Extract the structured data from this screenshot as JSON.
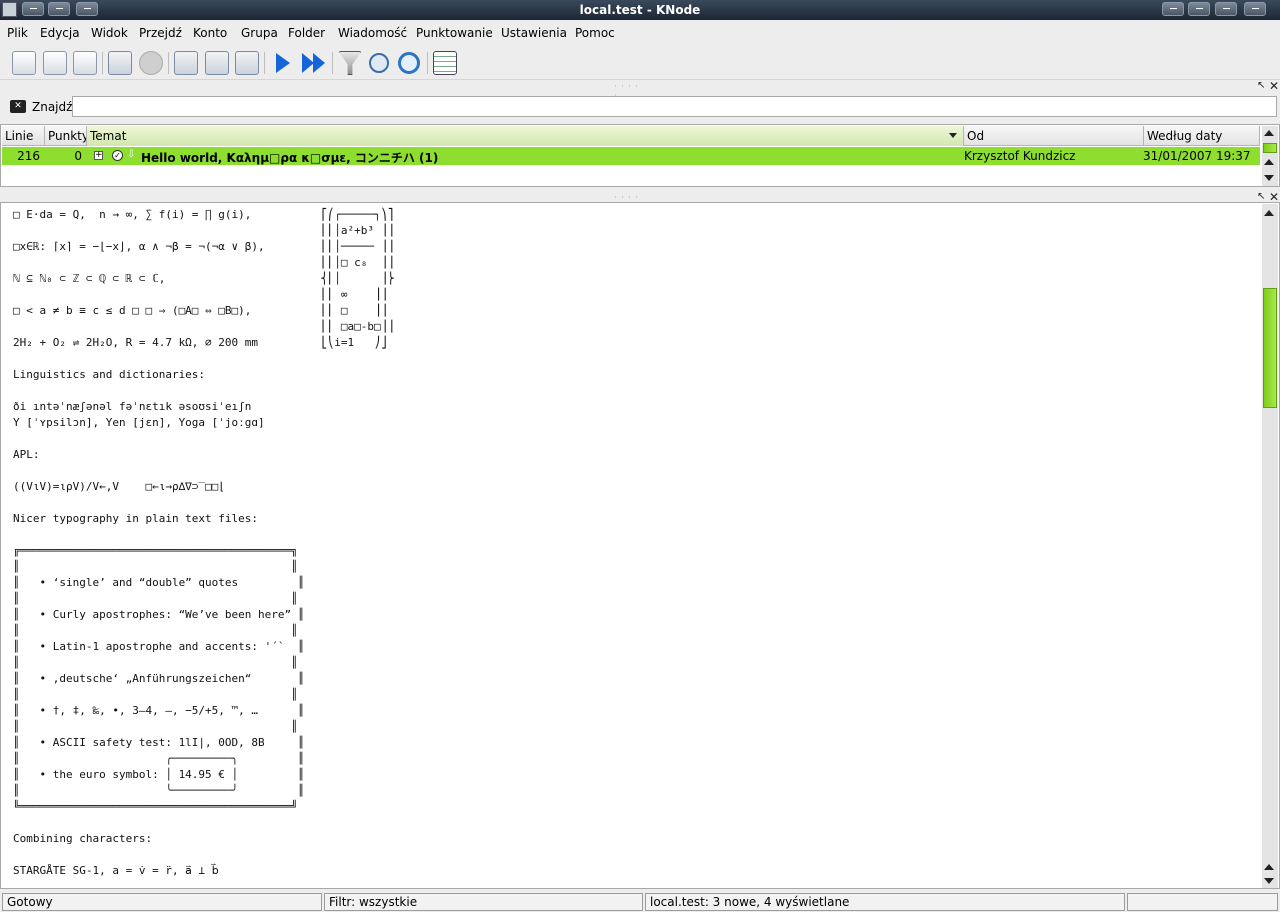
{
  "window": {
    "title": "local.test - KNode"
  },
  "menu": [
    "Plik",
    "Edycja",
    "Widok",
    "Przejdź",
    "Konto",
    "Grupa",
    "Folder",
    "Wiadomość",
    "Punktowanie",
    "Ustawienia",
    "Pomoc"
  ],
  "toolbar": {
    "icons": [
      "new-article-icon",
      "send-icon",
      "print-icon",
      "subscribe-icon",
      "cancel-icon",
      "post-icon",
      "reply-icon",
      "forward-icon",
      "next-unread-icon",
      "next-unread-thread-icon",
      "filter-icon",
      "search-icon",
      "refresh-icon",
      "view-table-icon"
    ]
  },
  "search": {
    "label": "Znajdź:",
    "value": "",
    "clear_icon": "clear-search-icon"
  },
  "list": {
    "columns": [
      "Linie",
      "Punkty",
      "Temat",
      "Od",
      "Według daty"
    ],
    "rows": [
      {
        "lines": "216",
        "score": "0",
        "subject": "Hello world, Καλημ□ρα κ□σμε, コンニチハ (1)",
        "from": "Krzysztof Kundzicz",
        "date": "31/01/2007 19:37"
      }
    ]
  },
  "article": {
    "lines": [
      "□ E·da = Q,  n → ∞, ∑ f(i) = ∏ g(i),",
      "",
      "□x∈ℝ: ⌈x⌉ = −⌊−x⌋, α ∧ ¬β = ¬(¬α ∨ β),",
      "",
      "ℕ ⊆ ℕ₀ ⊂ ℤ ⊂ ℚ ⊂ ℝ ⊂ ℂ,",
      "",
      "□ < a ≠ b ≡ c ≤ d □ □ ⇒ (□A□ ⇔ □B□),",
      "",
      "2H₂ + O₂ ⇌ 2H₂O, R = 4.7 kΩ, ⌀ 200 mm",
      "",
      "Linguistics and dictionaries:",
      "",
      "ði ıntəˈnæʃənəl fəˈnɛtık əsoʊsiˈeıʃn",
      "Y [ˈʏpsilɔn], Yen [jɛn], Yoga [ˈjoːgɑ]",
      "",
      "APL:",
      "",
      "((V⍳V)=⍳⍴V)/V←,V    □←⍳→⍴∆∇⊃‾□□⌊",
      "",
      "Nicer typography in plain text files:",
      "",
      "╔═════════════════════════════════════════╗",
      "║                                         ║",
      "║   • ‘single’ and “double” quotes         ║",
      "║                                         ║",
      "║   • Curly apostrophes: “We’ve been here” ║",
      "║                                         ║",
      "║   • Latin-1 apostrophe and accents: '´`  ║",
      "║                                         ║",
      "║   • ‚deutsche‘ „Anführungszeichen“       ║",
      "║                                         ║",
      "║   • †, ‡, ‰, •, 3–4, —, −5/+5, ™, …      ║",
      "║                                         ║",
      "║   • ASCII safety test: 1lI|, 0OD, 8B     ║",
      "║                      ╭─────────╮         ║",
      "║   • the euro symbol: │ 14.95 € │         ║",
      "║                      ╰─────────╯         ║",
      "╚═════════════════════════════════════════╝",
      "",
      "Combining characters:",
      "",
      "STARGÅTE SG-1, a = v̇ = r̈, a⃑ ⊥ b⃑"
    ],
    "matrix": "⎡⎛┌─────┐⎞⎤\n⎢⎜│a²+b³ ⎟⎥\n⎢⎜│───── ⎟⎥\n⎢⎜│□ c₈  ⎟⎥\n⎨⎜│      ⎟⎬\n⎢⎜ ∞    ⎟⎥\n⎢⎜ □    ⎟⎥\n⎢⎜ □a□-b□⎟⎥\n⎣⎝i=1   ⎠⎦"
  },
  "status": {
    "ready": "Gotowy",
    "filter": "Filtr: wszystkie",
    "group": "local.test: 3 nowe, 4 wyświetlane",
    "extra": ""
  }
}
